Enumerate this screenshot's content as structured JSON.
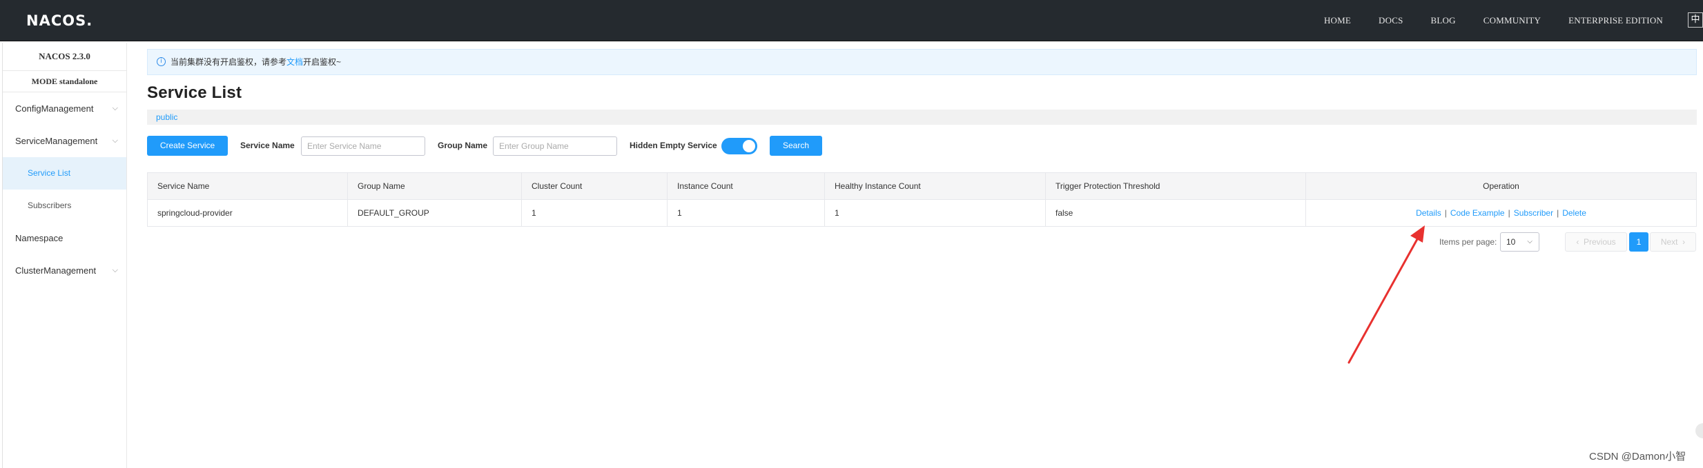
{
  "header": {
    "logo_text": "NACOS.",
    "nav": [
      "HOME",
      "DOCS",
      "BLOG",
      "COMMUNITY",
      "ENTERPRISE EDITION"
    ],
    "lang_toggle": "中"
  },
  "sidebar": {
    "version": "NACOS 2.3.0",
    "mode": "MODE standalone",
    "items": [
      {
        "label": "ConfigManagement",
        "icon": "chevron-down-icon"
      },
      {
        "label": "ServiceManagement",
        "icon": "chevron-down-icon"
      },
      {
        "label": "Service List"
      },
      {
        "label": "Subscribers"
      },
      {
        "label": "Namespace"
      },
      {
        "label": "ClusterManagement",
        "icon": "chevron-down-icon"
      }
    ],
    "active_item": "Service List"
  },
  "notice": {
    "text_before": "当前集群没有开启鉴权，请参考",
    "link_text": "文档",
    "text_after": "开启鉴权~"
  },
  "page_title": "Service List",
  "namespace": "public",
  "filters": {
    "create_button": "Create Service",
    "service_name_label": "Service Name",
    "service_name_placeholder": "Enter Service Name",
    "group_name_label": "Group Name",
    "group_name_placeholder": "Enter Group Name",
    "hidden_empty_label": "Hidden Empty Service",
    "hidden_empty_on": true,
    "search_button": "Search"
  },
  "table": {
    "columns": [
      "Service Name",
      "Group Name",
      "Cluster Count",
      "Instance Count",
      "Healthy Instance Count",
      "Trigger Protection Threshold",
      "Operation"
    ],
    "rows": [
      {
        "service_name": "springcloud-provider",
        "group_name": "DEFAULT_GROUP",
        "cluster_count": "1",
        "instance_count": "1",
        "healthy_instance_count": "1",
        "trigger_protection_threshold": "false",
        "operations": [
          "Details",
          "Code Example",
          "Subscriber",
          "Delete"
        ]
      }
    ]
  },
  "pagination": {
    "items_per_page_label": "Items per page:",
    "items_per_page": "10",
    "previous": "Previous",
    "current_page": "1",
    "next": "Next"
  },
  "watermark": "CSDN @Damon小智",
  "colors": {
    "accent": "#209bfa",
    "header_bg": "#252a2f",
    "annotation_arrow": "#e8312f"
  }
}
